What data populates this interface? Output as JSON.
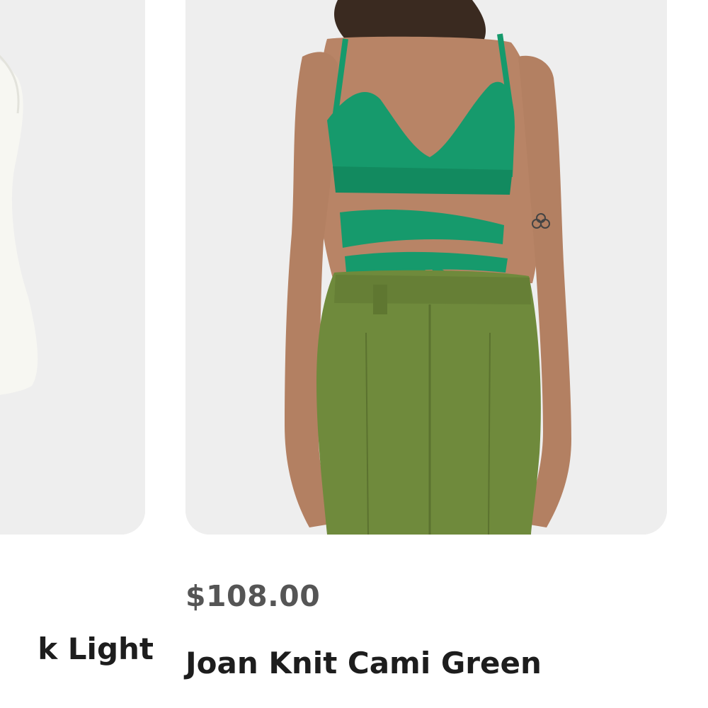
{
  "products": [
    {
      "name": "k Light",
      "image_alt": "white knit top"
    },
    {
      "price": "$108.00",
      "name": "Joan Knit Cami Green",
      "image_alt": "model wearing green knit wrap cami and olive trousers"
    }
  ],
  "colors": {
    "card_bg": "#efefef",
    "cami_green": "#169a6c",
    "pants_olive": "#6f8a3c",
    "price_text": "#555555",
    "name_text": "#1d1d1d"
  }
}
